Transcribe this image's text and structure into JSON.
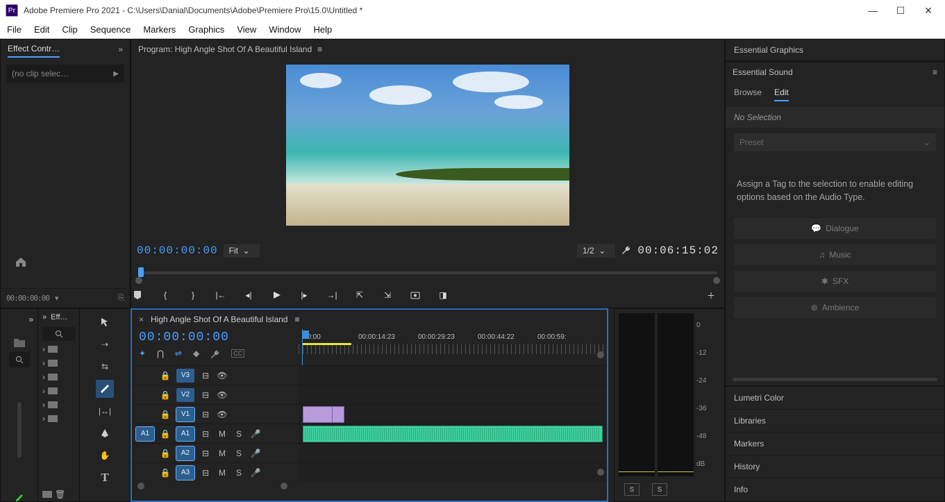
{
  "title": "Adobe Premiere Pro 2021 - C:\\Users\\Danial\\Documents\\Adobe\\Premiere Pro\\15.0\\Untitled *",
  "logo": "Pr",
  "menu": [
    "File",
    "Edit",
    "Clip",
    "Sequence",
    "Markers",
    "Graphics",
    "View",
    "Window",
    "Help"
  ],
  "effectControls": {
    "tab": "Effect Contr…",
    "slot": "(no clip selec…",
    "timecode": "00:00:00:00"
  },
  "program": {
    "title": "Program: High Angle Shot Of A Beautiful Island",
    "timecode_left": "00:00:00:00",
    "fit": "Fit",
    "scale": "1/2",
    "timecode_right": "00:06:15:02"
  },
  "effectsPanel": {
    "tab": "Eff…"
  },
  "timeline": {
    "title": "High Angle Shot Of A Beautiful Island",
    "timecode": "00:00:00:00",
    "ruler": [
      ":00:00",
      "00:00:14:23",
      "00:00:29:23",
      "00:00:44:22",
      "00:00:59:"
    ],
    "tracks": {
      "v3": "V3",
      "v2": "V2",
      "v1": "V1",
      "a1_src": "A1",
      "a1": "A1",
      "a2": "A2",
      "a3": "A3",
      "m": "M",
      "s": "S"
    }
  },
  "meters": {
    "scale": [
      "0",
      "-12",
      "-24",
      "-36",
      "-48",
      "dB"
    ],
    "solo": "S"
  },
  "right": {
    "graphics": "Essential Graphics",
    "sound": "Essential Sound",
    "tabs": {
      "browse": "Browse",
      "edit": "Edit"
    },
    "nosel": "No Selection",
    "preset": "Preset",
    "hint": "Assign a Tag to the selection to enable editing options based on the Audio Type.",
    "buttons": {
      "dialogue": "Dialogue",
      "music": "Music",
      "sfx": "SFX",
      "ambience": "Ambience"
    },
    "lower": [
      "Lumetri Color",
      "Libraries",
      "Markers",
      "History",
      "Info"
    ]
  }
}
